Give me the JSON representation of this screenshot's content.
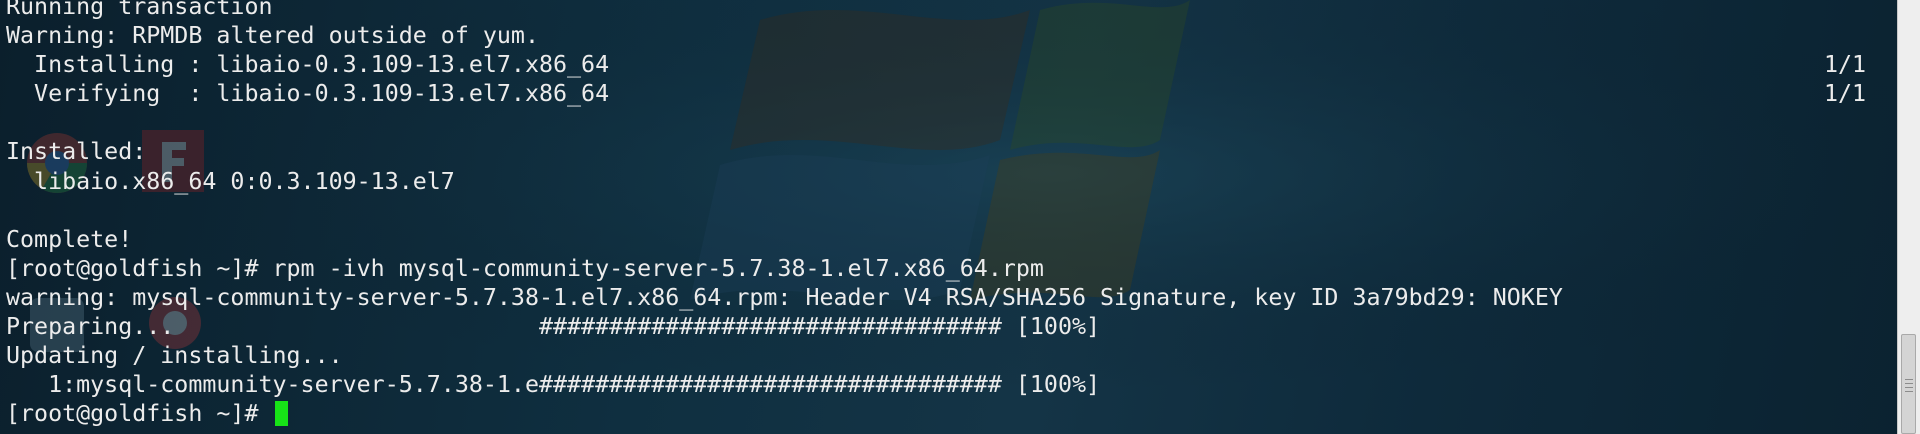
{
  "terminal": {
    "lines": [
      "Running transaction",
      "Warning: RPMDB altered outside of yum.",
      "  Installing : libaio-0.3.109-13.el7.x86_64",
      "  Verifying  : libaio-0.3.109-13.el7.x86_64",
      "",
      "Installed:",
      "  libaio.x86_64 0:0.3.109-13.el7",
      "",
      "Complete!",
      "[root@goldfish ~]# rpm -ivh mysql-community-server-5.7.38-1.el7.x86_64.rpm",
      "warning: mysql-community-server-5.7.38-1.el7.x86_64.rpm: Header V4 RSA/SHA256 Signature, key ID 3a79bd29: NOKEY",
      "Preparing...                          ################################# [100%]",
      "Updating / installing...",
      "   1:mysql-community-server-5.7.38-1.e################################# [100%]",
      "[root@goldfish ~]# "
    ],
    "progress_installing": "1/1",
    "progress_verifying": "1/1"
  },
  "colors": {
    "text": "#ececec",
    "cursor": "#17e317",
    "background": "#0d2534"
  }
}
